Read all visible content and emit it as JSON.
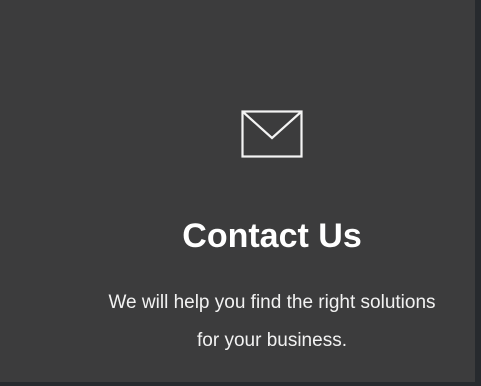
{
  "contact_card": {
    "icon": "envelope-icon",
    "title": "Contact Us",
    "description_line_1": "We will help you find the right solutions",
    "description_line_2": "for your business."
  },
  "colors": {
    "page_background": "#272a2e",
    "card_background": "#3c3c3d",
    "text": "#ffffff"
  }
}
